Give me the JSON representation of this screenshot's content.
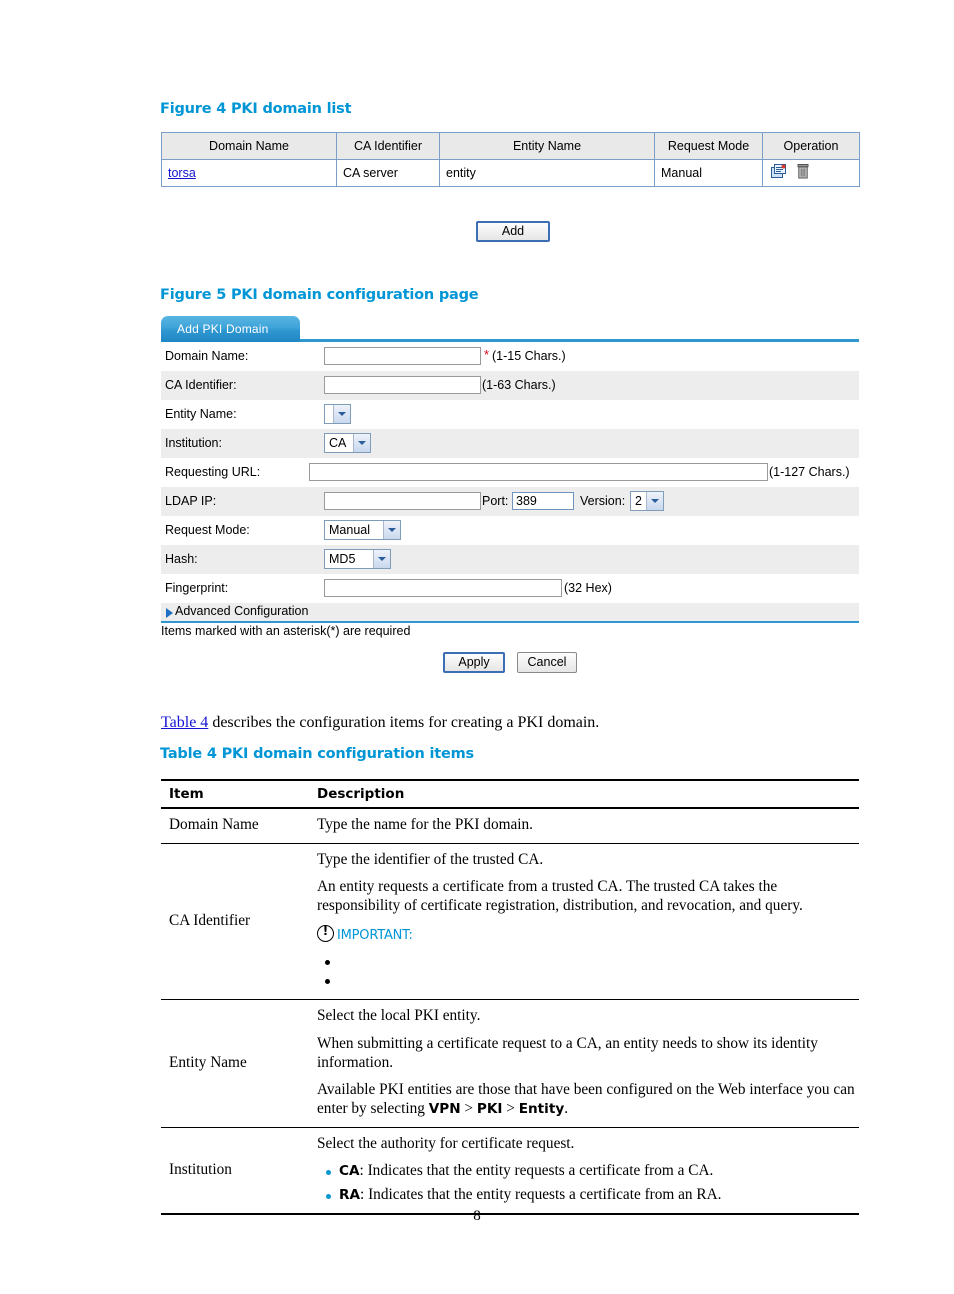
{
  "figure4": {
    "caption": "Figure 4 PKI domain list",
    "table": {
      "headers": [
        "Domain Name",
        "CA Identifier",
        "Entity Name",
        "Request Mode",
        "Operation"
      ],
      "rows": [
        {
          "domain_name": "torsa",
          "ca_identifier": "CA server",
          "entity_name": "entity",
          "request_mode": "Manual",
          "operations": [
            "certificate-icon",
            "delete-icon"
          ]
        }
      ]
    },
    "add_button": "Add"
  },
  "figure5": {
    "caption": "Figure 5 PKI domain configuration page",
    "tab": "Add PKI Domain",
    "fields": {
      "domain_name": {
        "label": "Domain Name:",
        "value": "",
        "required_mark": "*",
        "hint": "(1-15 Chars.)"
      },
      "ca_identifier": {
        "label": "CA Identifier:",
        "value": "",
        "hint": "(1-63 Chars.)"
      },
      "entity_name": {
        "label": "Entity Name:",
        "selected": ""
      },
      "institution": {
        "label": "Institution:",
        "selected": "CA"
      },
      "requesting_url": {
        "label": "Requesting URL:",
        "value": "",
        "hint": "(1-127 Chars.)"
      },
      "ldap_ip": {
        "label": "LDAP IP:",
        "value": "",
        "port_label": "Port:",
        "port_value": "389",
        "version_label": "Version:",
        "version_selected": "2"
      },
      "request_mode": {
        "label": "Request Mode:",
        "selected": "Manual"
      },
      "hash": {
        "label": "Hash:",
        "selected": "MD5"
      },
      "fingerprint": {
        "label": "Fingerprint:",
        "value": "",
        "hint": "(32 Hex)"
      }
    },
    "advanced_configuration": "Advanced Configuration",
    "required_note": "Items marked with an asterisk(*) are required",
    "apply_button": "Apply",
    "cancel_button": "Cancel"
  },
  "intro": {
    "link": "Table 4",
    "text": " describes the configuration items for creating a PKI domain."
  },
  "table4": {
    "caption": "Table 4 PKI domain configuration items",
    "headers": [
      "Item",
      "Description"
    ],
    "rows": [
      {
        "item": "Domain Name",
        "paragraphs": [
          "Type the name for the PKI domain."
        ]
      },
      {
        "item": "CA Identifier",
        "paragraphs": [
          "Type the identifier of the trusted CA.",
          "An entity requests a certificate from a trusted CA. The trusted CA takes the responsibility of certificate registration, distribution, and revocation, and query."
        ],
        "important_label": "IMPORTANT:",
        "blank_bullets": 2
      },
      {
        "item": "Entity Name",
        "paragraphs": [
          "Select the local PKI entity.",
          "When submitting a certificate request to a CA, an entity needs to show its identity information."
        ],
        "final_paragraph": {
          "pre": "Available PKI entities are those that have been configured on the Web interface you can enter by selecting ",
          "b1": "VPN",
          "sep1": " > ",
          "b2": "PKI",
          "sep2": " > ",
          "b3": "Entity",
          "post": "."
        }
      },
      {
        "item": "Institution",
        "paragraphs": [
          "Select the authority for certificate request."
        ],
        "bullets": [
          {
            "bold": "CA",
            "text": ": Indicates that the entity requests a certificate from a CA."
          },
          {
            "bold": "RA",
            "text": ": Indicates that the entity requests a certificate from an RA."
          }
        ]
      }
    ]
  },
  "footer": {
    "page_number": "8"
  },
  "colors": {
    "heading_blue": "#0096d6",
    "link_blue": "#1414d2",
    "tab_blue": "#2f97d0",
    "required_red": "#e2001a",
    "row_alt": "#ededed"
  }
}
